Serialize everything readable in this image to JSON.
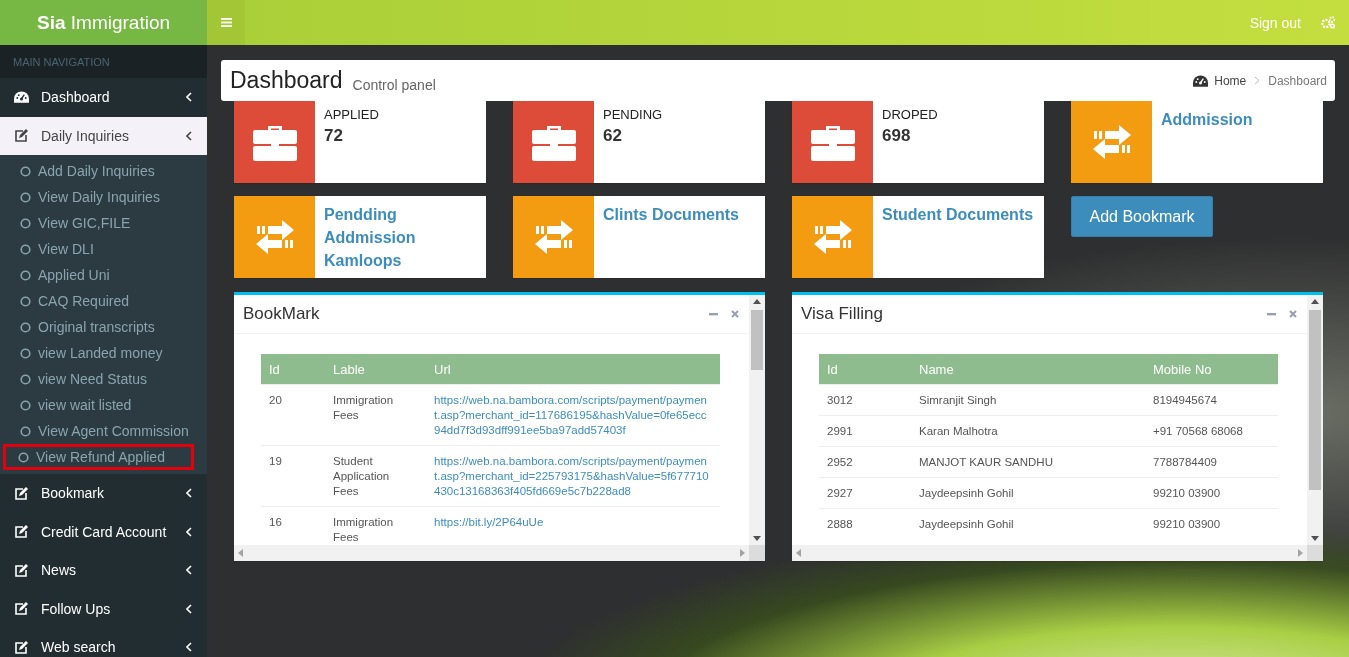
{
  "brand": {
    "bold": "Sia",
    "rest": "Immigration"
  },
  "topbar": {
    "sign_out": "Sign out"
  },
  "sidebar": {
    "header": "MAIN NAVIGATION",
    "items": [
      {
        "label": "Dashboard",
        "kind": "gauge",
        "selected": false
      },
      {
        "label": "Daily Inquiries",
        "kind": "edit",
        "selected": true,
        "children": [
          {
            "label": "Add Daily Inquiries",
            "highlighted": false
          },
          {
            "label": "View Daily Inquiries",
            "highlighted": false
          },
          {
            "label": "View GIC,FILE",
            "highlighted": false
          },
          {
            "label": "View DLI",
            "highlighted": false
          },
          {
            "label": "Applied Uni",
            "highlighted": false
          },
          {
            "label": "CAQ Required",
            "highlighted": false
          },
          {
            "label": "Original transcripts",
            "highlighted": false
          },
          {
            "label": "view Landed money",
            "highlighted": false
          },
          {
            "label": "view Need Status",
            "highlighted": false
          },
          {
            "label": "view wait listed",
            "highlighted": false
          },
          {
            "label": "View Agent Commission",
            "highlighted": false
          },
          {
            "label": "View Refund Applied",
            "highlighted": true
          }
        ]
      },
      {
        "label": "Bookmark",
        "kind": "edit",
        "selected": false
      },
      {
        "label": "Credit Card Account",
        "kind": "edit",
        "selected": false
      },
      {
        "label": "News",
        "kind": "edit",
        "selected": false
      },
      {
        "label": "Follow Ups",
        "kind": "edit",
        "selected": false
      },
      {
        "label": "Web search",
        "kind": "edit",
        "selected": false
      }
    ]
  },
  "page_header": {
    "title": "Dashboard",
    "subtitle": "Control panel",
    "breadcrumb": [
      "Home",
      "Dashboard"
    ]
  },
  "info_boxes": [
    {
      "kind": "count",
      "label": "APPLIED",
      "value": "72"
    },
    {
      "kind": "count",
      "label": "PENDING",
      "value": "62"
    },
    {
      "kind": "count",
      "label": "DROPED",
      "value": "698"
    },
    {
      "kind": "link",
      "title": "Addmission"
    },
    {
      "kind": "link",
      "title": "Pendding Addmission Kamloops"
    },
    {
      "kind": "link",
      "title": "Clints Documents"
    },
    {
      "kind": "link",
      "title": "Student Documents"
    }
  ],
  "add_bookmark_button": "Add Bookmark",
  "panels": [
    {
      "title": "BookMark",
      "columns": [
        {
          "label": "Id",
          "kind": "text"
        },
        {
          "label": "Lable",
          "kind": "text"
        },
        {
          "label": "Url",
          "kind": "link"
        }
      ],
      "rows": [
        [
          "20",
          "Immigration Fees",
          "https://web.na.bambora.com/scripts/payment/payment.asp?merchant_id=117686195&hashValue=0fe65ecc94dd7f3d93dff991ee5ba97add57403f"
        ],
        [
          "19",
          "Student Application Fees",
          "https://web.na.bambora.com/scripts/payment/payment.asp?merchant_id=225793175&hashValue=5f677710430c13168363f405fd669e5c7b228ad8"
        ],
        [
          "16",
          "Immigration Fees",
          "https://bit.ly/2P64uUe"
        ]
      ]
    },
    {
      "title": "Visa Filling",
      "columns": [
        {
          "label": "Id",
          "kind": "text"
        },
        {
          "label": "Name",
          "kind": "text"
        },
        {
          "label": "Mobile No",
          "kind": "text"
        }
      ],
      "rows": [
        [
          "3012",
          "Simranjit Singh",
          "8194945674"
        ],
        [
          "2991",
          "Karan Malhotra",
          "+91 70568 68068"
        ],
        [
          "2952",
          "MANJOT KAUR SANDHU",
          "7788784409"
        ],
        [
          "2927",
          "Jaydeepsinh Gohil",
          "99210 03900"
        ],
        [
          "2888",
          "Jaydeepsinh Gohil",
          "99210 03900"
        ]
      ]
    }
  ]
}
